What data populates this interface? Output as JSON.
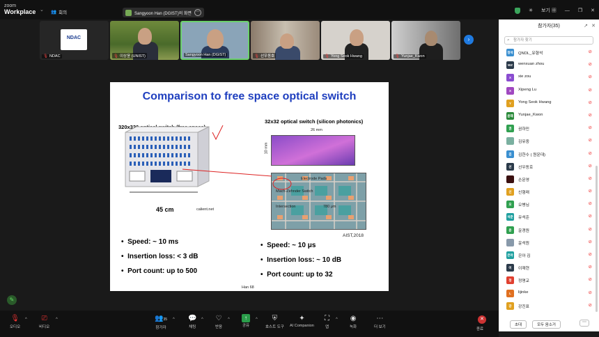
{
  "topbar": {
    "brand_small": "zoom",
    "brand_name": "Workplace",
    "meeting_label": "회의",
    "share_label": "Sangyoon Han (DGIST)의 화면",
    "view_label": "보기"
  },
  "video_tiles": [
    {
      "name": "NDAC",
      "logo_text": "NDAC"
    },
    {
      "name": "이상윤 (UNIST)"
    },
    {
      "name": "Sangyoon Han (DGIST)"
    },
    {
      "name": "선우동호"
    },
    {
      "name": "Yong Seok Hwang"
    },
    {
      "name": "Yunjae_Kwon"
    }
  ],
  "slide": {
    "title": "Comparison to free space optical switch",
    "left_sub": "320x320 optical switch (free space)",
    "right_sub": "32x32 optical switch (silicon photonics)",
    "dim_45": "45 cm",
    "calient": "calient.net",
    "dim_26": "26 mm",
    "dim_10": "10 mm",
    "lbl_electrode": "Electrode Pads",
    "lbl_mach": "Mach-Zehnder Switch",
    "lbl_inter": "Intersection",
    "lbl_780": "780 μm",
    "aist": "AIST,2018",
    "footer": "Han 68",
    "left_bullets": [
      "Speed: ~ 10 ms",
      "Insertion loss: < 3 dB",
      "Port count: up to 500"
    ],
    "right_bullets": [
      "Speed: ~ 10 μs",
      "Insertion loss: ~ 10 dB",
      "Port count: up to 32"
    ]
  },
  "panel": {
    "title": "참가자(35)",
    "search_placeholder": "참가자 찾기",
    "invite_label": "초대",
    "mute_all_label": "모두 음소거",
    "participants": [
      {
        "initials": "정석",
        "name": "QNDL_유형석",
        "color": "#3a8fd0"
      },
      {
        "initials": "WZ",
        "name": "wenxuan zhou",
        "color": "#2b3a4a"
      },
      {
        "initials": "X",
        "name": "xie zou",
        "color": "#8a4cd0"
      },
      {
        "initials": "X",
        "name": "Xipeng Lu",
        "color": "#a048c0"
      },
      {
        "initials": "Y",
        "name": "Yong Seok Hwang",
        "color": "#e0a020"
      },
      {
        "initials": "윤재",
        "name": "Yunjae_Kwon",
        "color": "#2a8a3a"
      },
      {
        "initials": "권",
        "name": "권하민",
        "color": "#30a050"
      },
      {
        "initials": "",
        "name": "김유중",
        "color": "#7ab0a0"
      },
      {
        "initials": "김",
        "name": "김한수 ( 원운대)",
        "color": "#3a8fd0"
      },
      {
        "initials": "선",
        "name": "선우동호",
        "color": "#2b3a4a"
      },
      {
        "initials": "",
        "name": "손문영",
        "color": "#3a1010"
      },
      {
        "initials": "신",
        "name": "신형래",
        "color": "#e0a020"
      },
      {
        "initials": "오",
        "name": "오병님",
        "color": "#30a050"
      },
      {
        "initials": "석준",
        "name": "유석준",
        "color": "#20a0a0"
      },
      {
        "initials": "윤",
        "name": "윤경원",
        "color": "#30a050"
      },
      {
        "initials": "",
        "name": "윤석원",
        "color": "#8899aa"
      },
      {
        "initials": "은아",
        "name": "은아 김",
        "color": "#20a0a0"
      },
      {
        "initials": "이",
        "name": "이재현",
        "color": "#2b3a4a"
      },
      {
        "initials": "정",
        "name": "정명교",
        "color": "#e04030"
      },
      {
        "initials": "L",
        "name": "lijinke",
        "color": "#e07020"
      },
      {
        "initials": "강",
        "name": "강진표",
        "color": "#e0a020"
      }
    ]
  },
  "bottombar": {
    "audio": "오디오",
    "video": "비디오",
    "participants": "참가자",
    "participants_count": "35",
    "chat": "채팅",
    "react": "반응",
    "share": "공유",
    "host_tools": "호스트 도구",
    "ai": "AI Companion",
    "apps": "앱",
    "record": "녹화",
    "more": "더 보기",
    "end": "종료"
  }
}
